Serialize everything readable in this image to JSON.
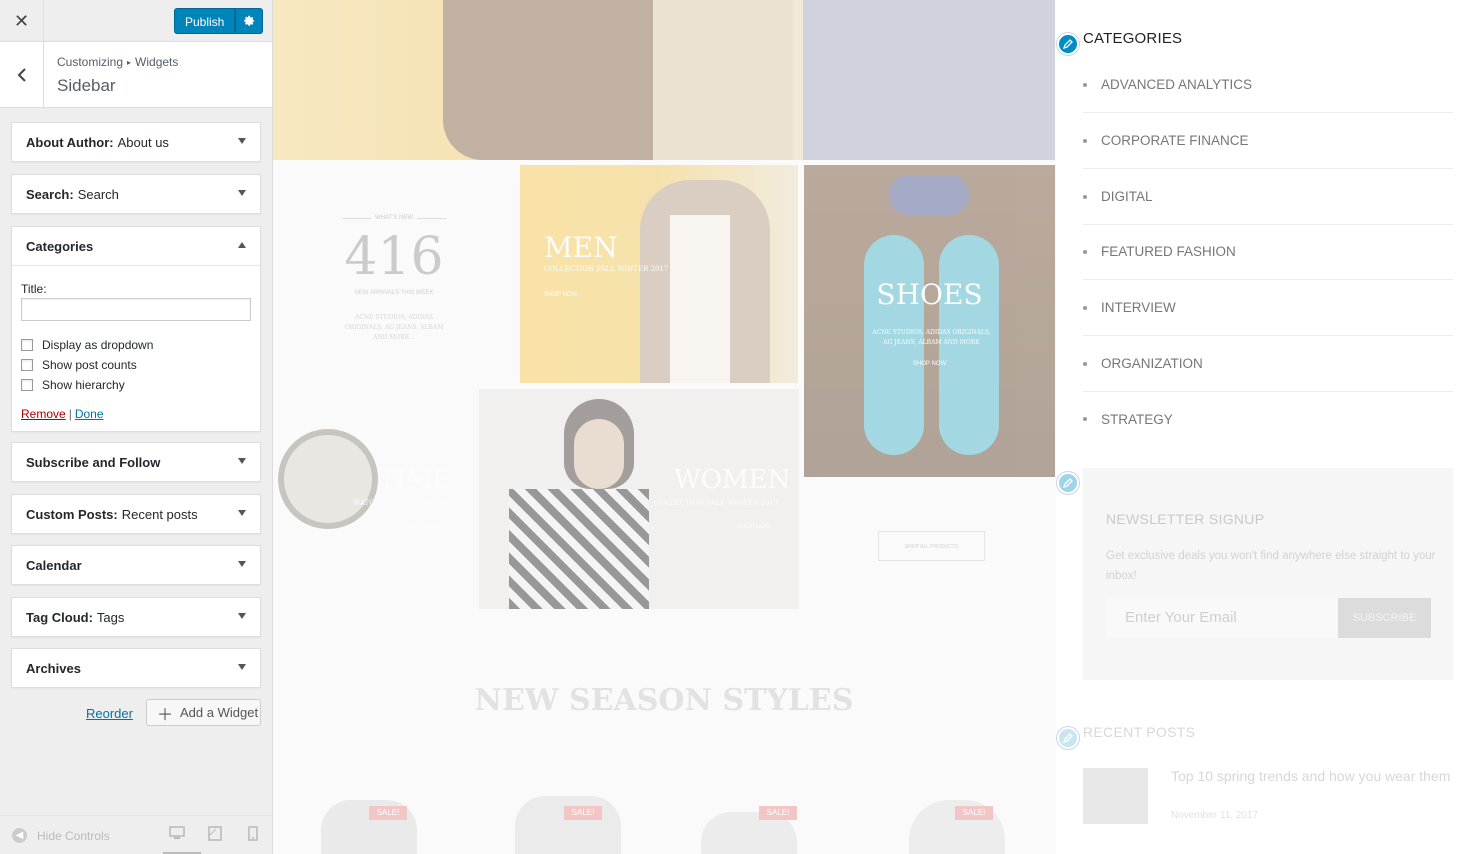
{
  "header": {
    "close_icon": "close-icon",
    "publish_label": "Publish",
    "settings_icon": "gear-icon"
  },
  "breadcrumb": {
    "root": "Customizing",
    "sep": "▸",
    "current": "Widgets",
    "section_title": "Sidebar"
  },
  "widgets": [
    {
      "title": "About Author:",
      "subtitle": "About us"
    },
    {
      "title": "Search:",
      "subtitle": "Search"
    },
    {
      "title": "Categories",
      "subtitle": ""
    },
    {
      "title": "Subscribe and Follow",
      "subtitle": ""
    },
    {
      "title": "Custom Posts:",
      "subtitle": "Recent posts"
    },
    {
      "title": "Calendar",
      "subtitle": ""
    },
    {
      "title": "Tag Cloud:",
      "subtitle": "Tags"
    },
    {
      "title": "Archives",
      "subtitle": ""
    }
  ],
  "categories_form": {
    "title_label": "Title:",
    "title_value": "",
    "options": [
      {
        "label": "Display as dropdown",
        "checked": false
      },
      {
        "label": "Show post counts",
        "checked": false
      },
      {
        "label": "Show hierarchy",
        "checked": false
      }
    ],
    "remove_label": "Remove",
    "separator": "|",
    "done_label": "Done"
  },
  "footer_actions": {
    "reorder_label": "Reorder",
    "add_widget_label": "Add a Widget"
  },
  "bottom_bar": {
    "hide_controls_label": "Hide Controls"
  },
  "preview": {
    "promo_whats_new": "WHAT'S NEW",
    "promo_number": "416",
    "promo_new_arrivals": "NEW ARRIVALS THIS WEEK",
    "promo_brands": "ACNE STUDIOS, ADIDAS ORIGINALS, AG JEANS, ALBAM AND MORE...",
    "men_title": "MEN",
    "men_sub": "COLLECTION FALL WINTER 2017",
    "men_cta": "SHOP NOW",
    "shoes_title": "SHOES",
    "shoes_sub": "ACNE STUDIOS, ADIDAS ORIGINALS, AG JEANS, ALBAM AND MORE",
    "shoes_cta": "SHOP NOW",
    "time_title": "TIME",
    "time_sub": "WATCH COLLECTION 2017",
    "time_cta": "SHOP NOW",
    "women_title": "WOMEN",
    "women_sub": "COLLECTION FALL WINTER 2017",
    "women_cta": "SHOP NOW",
    "shop_all": "SHOP ALL PRODUCTS",
    "section_heading": "NEW SEASON STYLES",
    "sale_badge": "SALE!"
  },
  "sidebar_preview": {
    "categories_title": "CATEGORIES",
    "categories": [
      "ADVANCED ANALYTICS",
      "CORPORATE FINANCE",
      "DIGITAL",
      "FEATURED FASHION",
      "INTERVIEW",
      "ORGANIZATION",
      "STRATEGY"
    ],
    "newsletter_title": "NEWSLETTER SIGNUP",
    "newsletter_desc": "Get exclusive deals you won't find anywhere else straight to your inbox!",
    "email_placeholder": "Enter Your Email",
    "subscribe_label": "SUBSCRIBE",
    "recent_posts_title": "RECENT POSTS",
    "recent_post_link": "Top 10 spring trends and how you wear them",
    "recent_post_date": "November 11, 2017"
  },
  "colors": {
    "accent": "#0085ba",
    "remove": "#aa0000",
    "link": "#0073aa"
  }
}
